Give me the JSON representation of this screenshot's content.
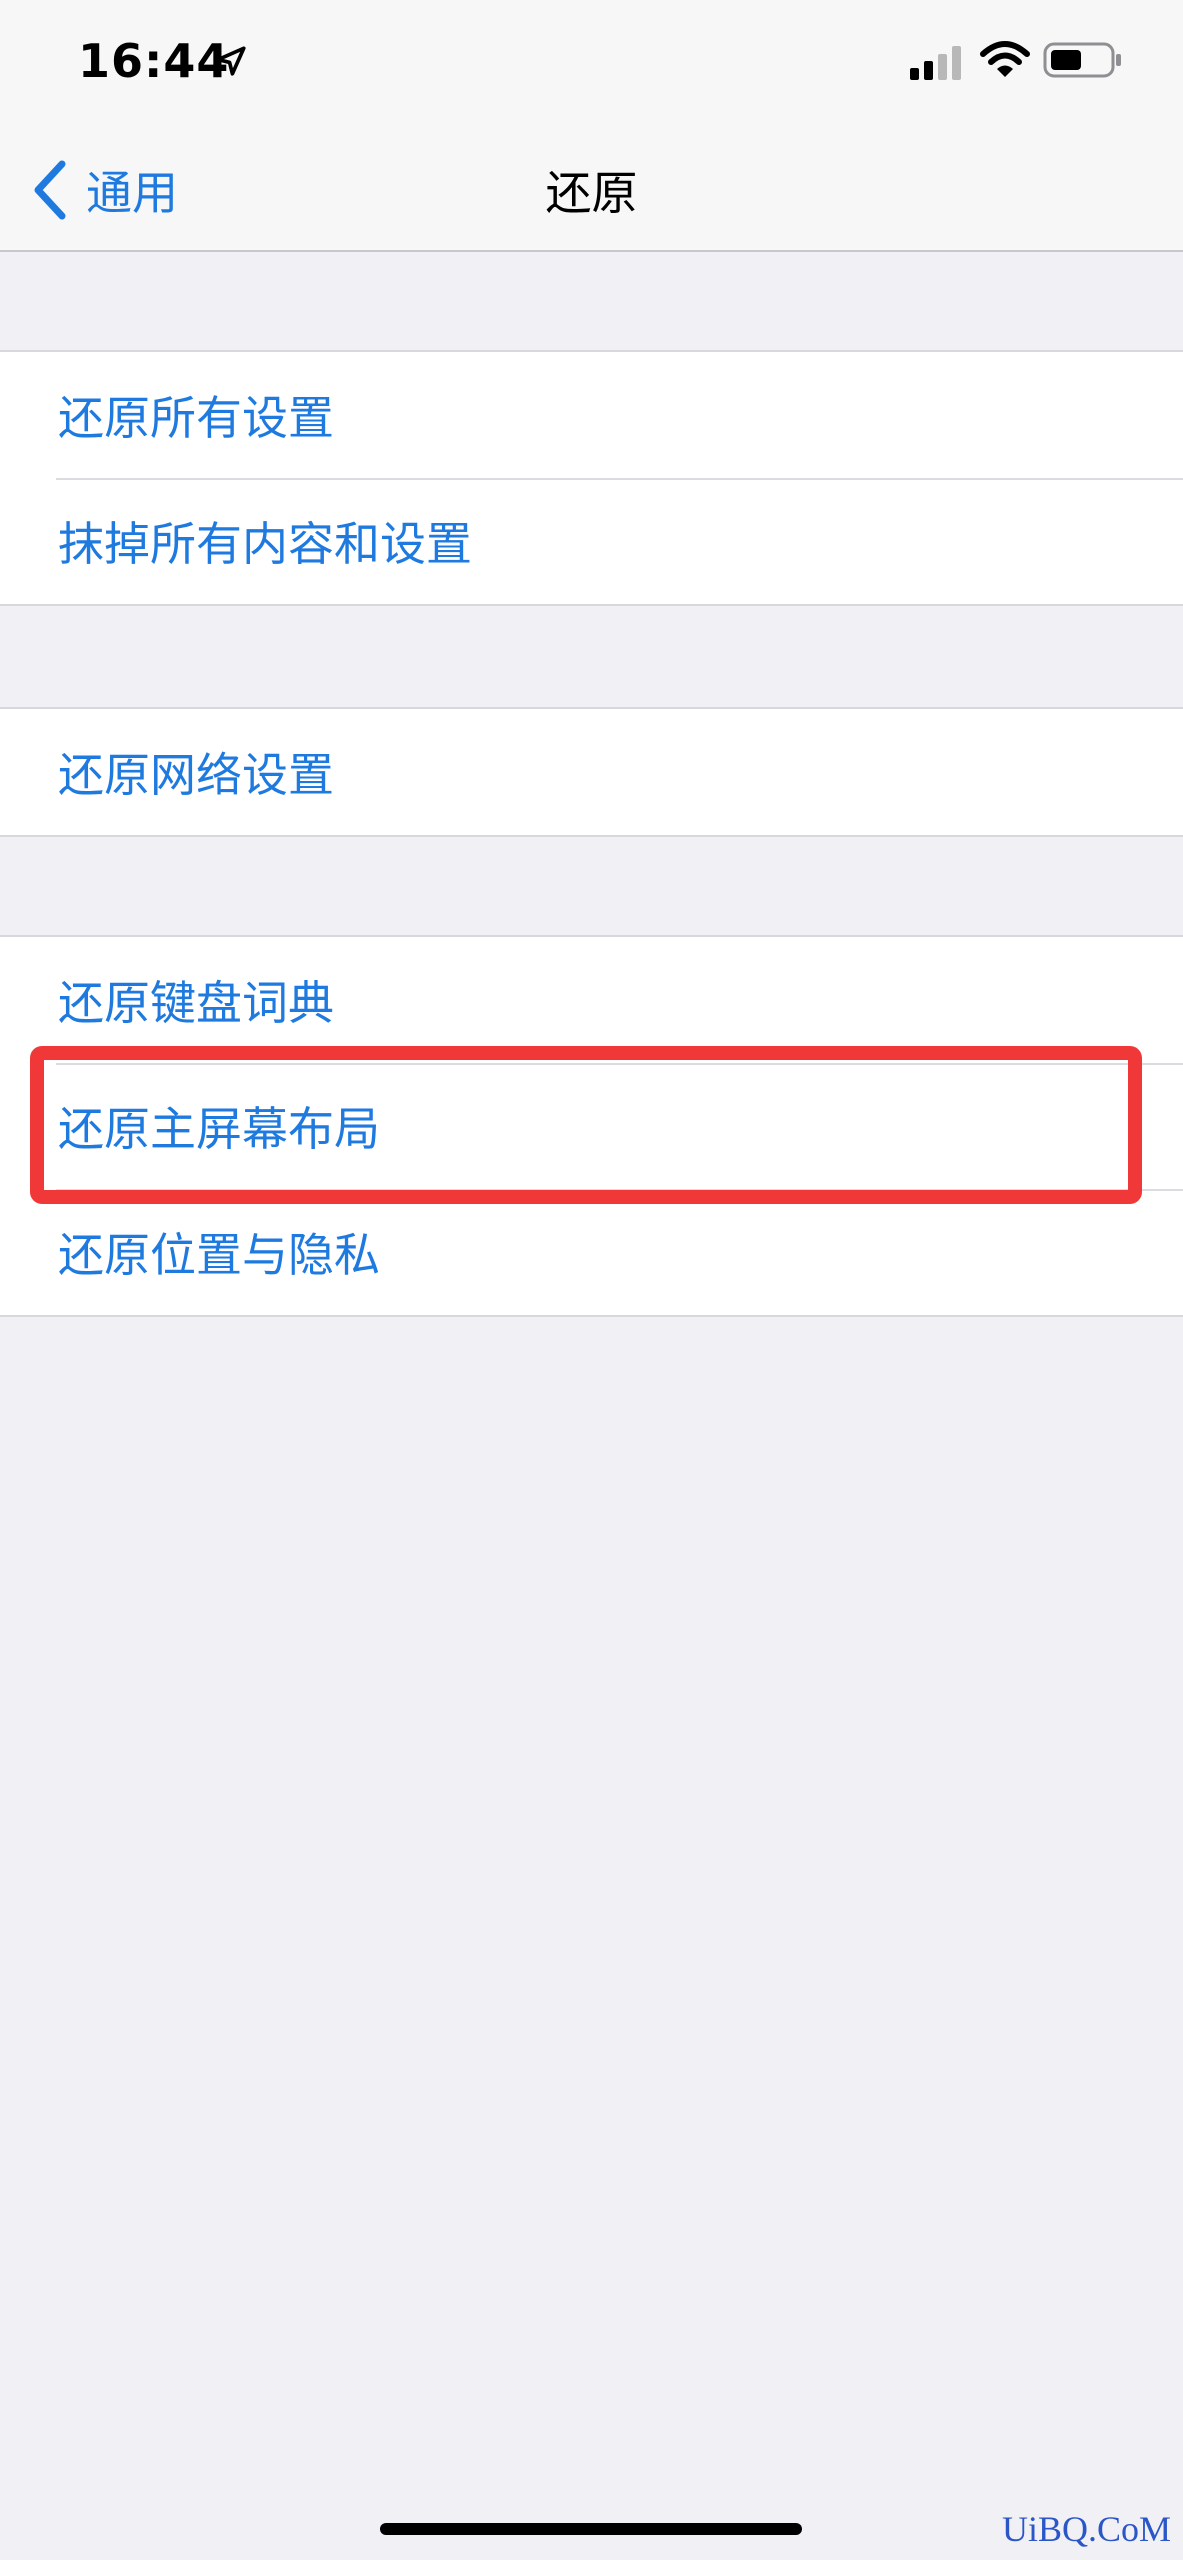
{
  "status_bar": {
    "time": "16:44",
    "icons": [
      "location-arrow-icon",
      "cellular-signal-icon",
      "wifi-icon",
      "battery-icon"
    ]
  },
  "nav": {
    "back_label": "通用",
    "title": "还原"
  },
  "groups": [
    {
      "items": [
        {
          "label": "还原所有设置"
        },
        {
          "label": "抹掉所有内容和设置"
        }
      ]
    },
    {
      "items": [
        {
          "label": "还原网络设置"
        }
      ]
    },
    {
      "items": [
        {
          "label": "还原键盘词典"
        },
        {
          "label": "还原主屏幕布局"
        },
        {
          "label": "还原位置与隐私"
        }
      ]
    }
  ],
  "highlighted_item": "还原主屏幕布局",
  "watermark": "UiBQ.CoM",
  "colors": {
    "accent": "#1f7ae0",
    "highlight": "#f03838",
    "background": "#f0f0f5"
  }
}
